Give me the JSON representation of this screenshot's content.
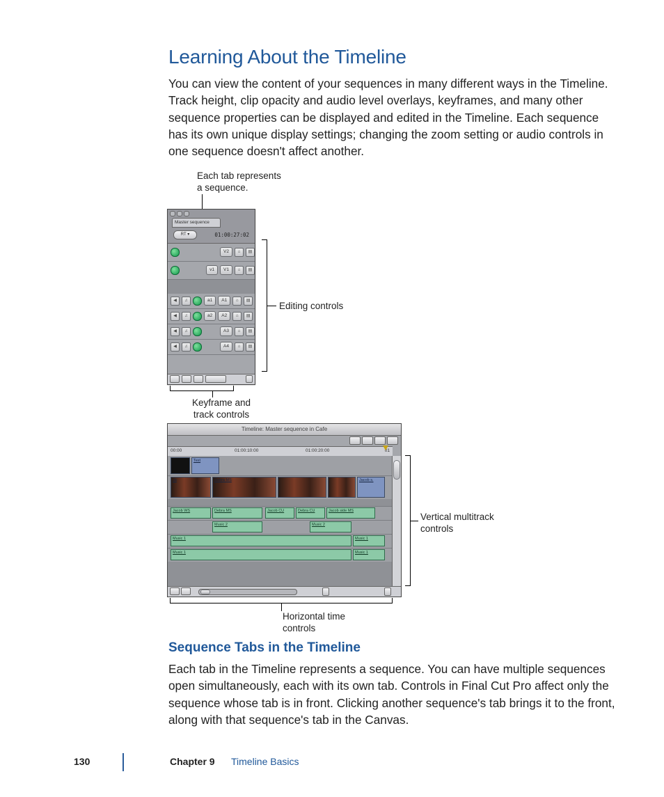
{
  "heading1": "Learning About the Timeline",
  "para1": "You can view the content of your sequences in many different ways in the Timeline. Track height, clip opacity and audio level overlays, keyframes, and many other sequence properties can be displayed and edited in the Timeline. Each sequence has its own unique display settings; changing the zoom setting or audio controls in one sequence doesn't affect another.",
  "heading2": "Sequence Tabs in the Timeline",
  "para2": "Each tab in the Timeline represents a sequence. You can have multiple sequences open simultaneously, each with its own tab. Controls in Final Cut Pro affect only the sequence whose tab is in front. Clicking another sequence's tab brings it to the front, along with that sequence's tab in the Canvas.",
  "fig1": {
    "callout_tab": "Each tab represents a sequence.",
    "callout_edit": "Editing controls",
    "callout_keyframe": "Keyframe and track controls",
    "tab_label": "Master sequence",
    "rt_label": "RT ▾",
    "timecode": "01:00:27:02",
    "video_tracks": [
      {
        "left": "",
        "right": "V2"
      },
      {
        "left": "v1",
        "right": "V1"
      }
    ],
    "audio_tracks": [
      {
        "left": "a1",
        "right": "A1"
      },
      {
        "left": "a2",
        "right": "A2"
      },
      {
        "left": "",
        "right": "A3"
      },
      {
        "left": "",
        "right": "A4"
      }
    ]
  },
  "fig2": {
    "title": "Timeline: Master sequence in Cafe",
    "ruler": {
      "t0": "00:00",
      "t1": "01:00:10:00",
      "t2": "01:00:20:00",
      "t3": "01"
    },
    "v2": {
      "text_label": "Text"
    },
    "v1_clips": [
      "Ja",
      "Debra MS",
      "Jacob s."
    ],
    "a1_clips": [
      "Jacob WS",
      "Debra MS",
      "Jacob CU",
      "Debra CU",
      "Jacob side MS"
    ],
    "a2_clips": [
      "Music 2",
      "Music 2"
    ],
    "a3_clips": [
      "Music 1",
      "Music 1"
    ],
    "a4_clips": [
      "Music 1",
      "Music 1"
    ],
    "callout_vertical": "Vertical multitrack controls",
    "callout_horizontal": "Horizontal time controls"
  },
  "footer": {
    "page": "130",
    "chapter_label": "Chapter 9",
    "chapter_title": "Timeline Basics"
  }
}
